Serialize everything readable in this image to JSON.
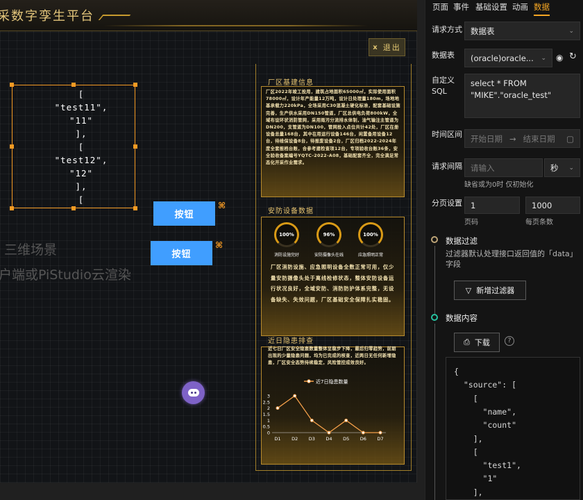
{
  "canvas": {
    "platform_title": "采数字孪生平台",
    "exit_label": "退出",
    "exit_icon": "x",
    "json_widget_text": "[\n\"test11\",\n\"11\"\n],\n[\n\"test12\",\n\"12\"\n],\n[",
    "button1": "按钮",
    "button2": "按钮",
    "ghost_line1": "三维场景",
    "ghost_line2": "户端或PiStudio云渲染"
  },
  "panels": {
    "p1_title": "厂区基建信息",
    "p1_text": "厂区2022年竣工投用，建筑占地面积65000㎡，实际使用面积78000㎡，设计年产能量12万吨，设计日处理量180m，场地地基承载力220kPa，全场采用C30混凝土硬化标准，配套基础设施完善，生产供水采用DN150管道，厂区总供电负荷800kW，全域布设环状消防管网，采用雨污分流排水体制，油气输注主管道为DN200，支管道为DN100，管网投入点位共计42处，厂区在册设备总量168台，其中在用运行设备146台，闲置备用设备12台，待维保设备8台，待报废设备2台，厂区归档2022-2024年度全套报档台账，合参考建检查项12台，专项验收台账36条，安全验收备案编号YQTC-2022-A08，基础配套齐全，完全满足常态化开采作业需求。",
    "p2_title": "安防设备数据",
    "gauges": [
      {
        "value": "100%",
        "label": "消防设施完好"
      },
      {
        "value": "96%",
        "label": "安防摄像头在线"
      },
      {
        "value": "100%",
        "label": "应急照明正常"
      }
    ],
    "p2_text": "厂区消防设施、应急照明设备全数正常可用，仅少量安防摄像头处于离线检修状态，整体安防设备运行状况良好，全域安防、消防防护体系完整，无设备缺失、失效问题，厂区基础安全保障扎实稳固。",
    "p3_title": "近日隐患排查",
    "p3_text": "近七日厂区安全隐患数量整体呈稳步下降，最后归零趋势，前期出现的少量隐患问题，均为已完成的核查，近两日无任何新增隐患，厂区安全态势持续稳定，风险管控成效良好。"
  },
  "chart_data": {
    "type": "line",
    "categories": [
      "D1",
      "D2",
      "D3",
      "D4",
      "D5",
      "D6",
      "D7"
    ],
    "series": [
      {
        "name": "近7日隐患数量",
        "values": [
          2,
          3,
          1,
          0,
          1,
          0,
          0
        ]
      }
    ],
    "y_ticks": [
      "0",
      "0.5",
      "1",
      "1.5",
      "2",
      "2.5",
      "3"
    ],
    "ylim": [
      0,
      3
    ],
    "color": "#f5a04a",
    "legend": "top-center",
    "grid": false
  },
  "side": {
    "tabs": [
      "页面",
      "事件",
      "基础设置",
      "动画",
      "数据"
    ],
    "active_tab": "数据",
    "request_method_label": "请求方式",
    "request_method_value": "数据表",
    "table_label": "数据表",
    "table_value": "(oracle)oracle...",
    "custom_sql_label1": "自定义",
    "custom_sql_label2": "SQL",
    "custom_sql_value": "select * FROM\n\"MIKE\".\"oracle_test\"",
    "time_range_label": "时间区间",
    "start_date_placeholder": "开始日期",
    "end_date_placeholder": "结束日期",
    "interval_label": "请求间隔",
    "interval_placeholder": "请输入",
    "interval_unit": "秒",
    "interval_hint": "缺省或为0时 仅初始化",
    "paging_label": "分页设置",
    "page_value": "1",
    "page_size_value": "1000",
    "page_label": "页码",
    "page_size_label": "每页条数",
    "filter_title": "数据过滤",
    "filter_desc": "过滤器默认处理接口返回值的「data」字段",
    "add_filter_label": "新增过滤器",
    "content_title": "数据内容",
    "download_label": "下载",
    "code_lines": [
      "{",
      "  \"source\": [",
      "    [",
      "      \"name\",",
      "      \"count\"",
      "    ],",
      "    [",
      "      \"test1\",",
      "      \"1\"",
      "    ],"
    ]
  }
}
